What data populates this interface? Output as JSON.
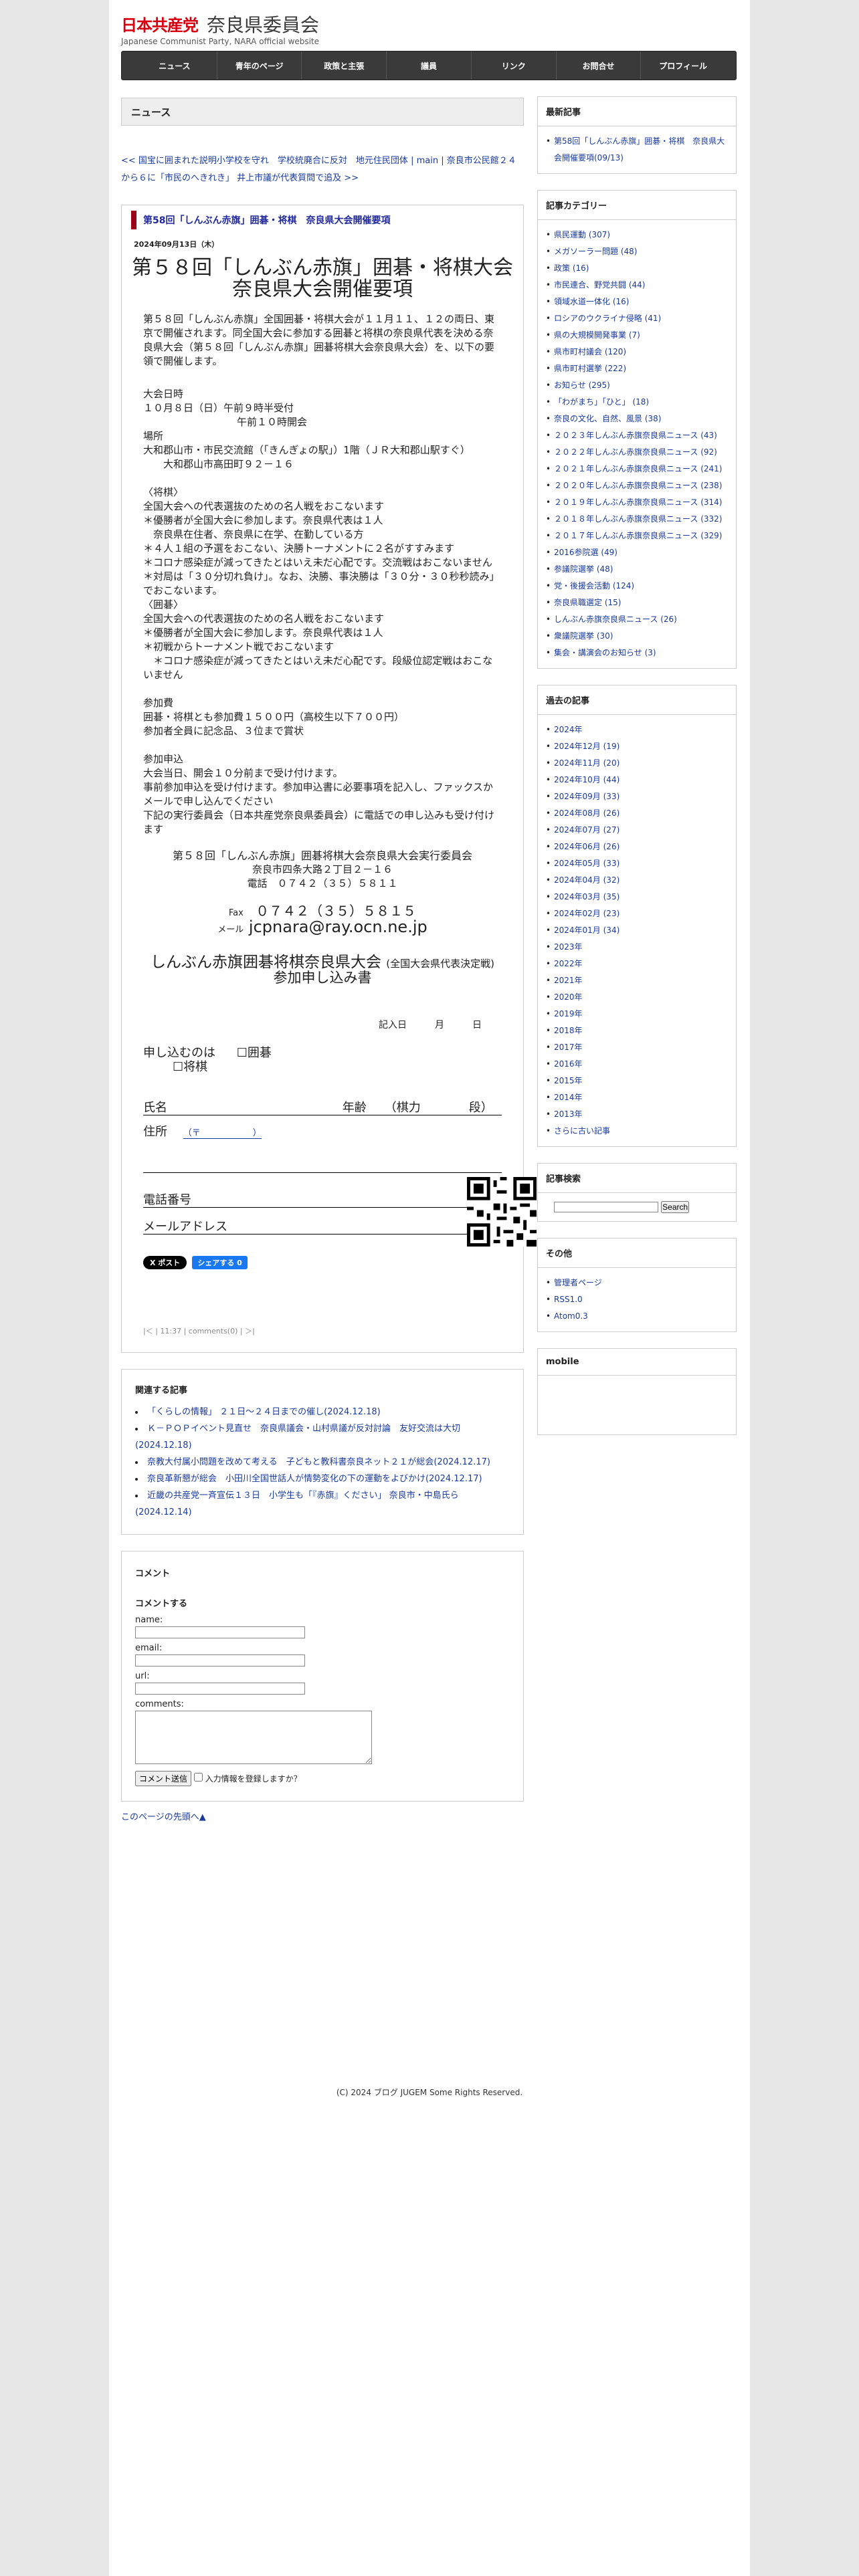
{
  "header": {
    "party": "日本共産党",
    "committee": "奈良県委員会",
    "subtitle": "Japanese Communist Party, NARA official website"
  },
  "nav": [
    "ニュース",
    "青年のページ",
    "政策と主張",
    "議員",
    "リンク",
    "お問合せ",
    "プロフィール"
  ],
  "main": {
    "section_title": "ニュース",
    "pager_prev": "<< 国宝に囲まれた説明小学校を守れ　学校統廃合に反対　地元住民団体",
    "pager_main": "main",
    "pager_next": "奈良市公民館２４から６に「市民のへきれき」 井上市議が代表質問で追及 >>",
    "entry": {
      "title": "第58回「しんぶん赤旗」囲碁・将棋　奈良県大会開催要項",
      "date": "2024年09月13日（木）",
      "big_title_1": "第５８回「しんぶん赤旗」囲碁・将棋大会",
      "big_title_2": "奈良県大会開催要項",
      "intro": "第５８回「しんぶん赤旗」全国囲碁・将棋大会が１１月１１、１２の両日、東京で開催されます。同全国大会に参加する囲碁と将棋の奈良県代表を決める奈良県大会（第５８回「しんぶん赤旗」囲碁将棋大会奈良県大会）を、以下の要領で開催します。",
      "date_h": "大会日時",
      "date_1": "１０月８日（日）午前９時半受付",
      "date_2": "午前１０時開会",
      "place_h": "場所",
      "place_1": "大和郡山市・市民交流館（「きんぎょの駅」）1階（ＪＲ大和郡山駅すぐ）",
      "place_2": "大和郡山市高田町９２－１６",
      "shogi_h": "〈将棋〉",
      "shogi_lines": [
        "全国大会への代表選抜のための名人戦をおこないます",
        "＊優勝者が全国大会に参加します。奈良県代表は１人",
        "　奈良県在住者、奈良県に在学、在勤している方",
        "＊４人１組の予選をおこない、決勝トーナメントに２名がすすみます",
        "＊コロナ感染症が減ってきたとはいえ未だ心配です。交流戦はおこないません",
        "＊対局は「３０分切れ負け」。なお、決勝、事決勝は「３０分・３０秒秒読み」でおこないます。"
      ],
      "go_h": "〈囲碁〉",
      "go_lines": [
        "全国大会への代表選抜のための名人戦をおこないます",
        "＊優勝者が全国大会に参加します。奈良県代表は１人",
        "＊初戦からトーナメント戦でおこないます",
        "　＊コロナ感染症が減ってきたとはいえ未だ心配です。段級位認定戦はおこないません"
      ],
      "fee_h": "参加費",
      "fee_1": "囲碁・将棋とも参加費１５００円（高校生以下７００円）",
      "fee_2": "参加者全員に記念品、３位まで賞状",
      "apply_h": "参加申込",
      "apply_lines": [
        "大会当日、開会１０分前まで受け付けます。",
        "事前参加申込を受け付けます。参加申込書に必要事項を記入し、ファックスかメールで申し込んでください",
        "下記の実行委員会（日本共産党奈良県委員会）に電話での申し込みも受け付けます"
      ],
      "committee": "第５８回「しんぶん赤旗」囲碁将棋大会奈良県大会実行委員会",
      "address": "奈良市四条大路２丁目２－１６",
      "tel": "電話　０７４２（３５）５８１１",
      "fax_label": "Fax",
      "fax": "０７４２（３５）５８１５",
      "mail_label": "メール",
      "mail": "jcpnara@ray.ocn.ne.jp",
      "form_title": "しんぶん赤旗囲碁将棋奈良県大会",
      "form_title_small": "(全国大会県代表決定戦)",
      "form_sub": "参加申し込み書",
      "form_date": "記入日　　　月　　　日",
      "form_apply": "申し込むのは",
      "form_go": "囲碁",
      "form_shogi": "将棋",
      "form_name": "氏名",
      "form_age": "年齢　　（棋力　　　　段）",
      "form_addr": "住所",
      "form_zip": "（〒　　　　　　）",
      "form_tel": "電話番号",
      "form_mail": "メールアドレス",
      "btn_x": "X ポスト",
      "btn_fb": "シェアする 0",
      "footer_links": "|＜ | 11:37 | comments(0) | ＞|"
    },
    "related": {
      "title": "関連する記事",
      "items": [
        "「くらしの情報」 ２１日〜２４日までの催し(2024.12.18)",
        "Ｋ－ＰＯＰイベント見直せ　奈良県議会・山村県議が反対討論　友好交流は大切(2024.12.18)",
        "奈教大付属小問題を改めて考える　子どもと教科書奈良ネット２１が総会(2024.12.17)",
        "奈良革新懇が総会　小田川全国世話人が情勢変化の下の運動をよびかけ(2024.12.17)",
        "近畿の共産党一斉宣伝１３日　小学生も「『赤旗』ください」 奈良市・中島氏ら(2024.12.14)"
      ]
    },
    "comment": {
      "title": "コメント",
      "sub": "コメントする",
      "name": "name:",
      "email": "email:",
      "url": "url:",
      "comments": "comments:",
      "submit": "コメント送信",
      "remember": "入力情報を登録しますか？"
    },
    "top_link": "このページの先頭へ▲"
  },
  "sidebar": {
    "recent_title": "最新記事",
    "recent_items": [
      "第58回「しんぶん赤旗」囲碁・将棋　奈良県大会開催要項(09/13)"
    ],
    "cat_title": "記事カテゴリー",
    "categories": [
      "県民運動 (307)",
      "メガソーラー問題 (48)",
      "政策 (16)",
      "市民連合、野党共闘 (44)",
      "領域水道一体化 (16)",
      "ロシアのウクライナ侵略 (41)",
      "県の大規模開発事業 (7)",
      "県市町村議会 (120)",
      "県市町村選挙 (222)",
      "お知らせ (295)",
      "「わがまち」「ひと」 (18)",
      "奈良の文化、自然、風景 (38)",
      "２０２３年しんぶん赤旗奈良県ニュース (43)",
      "２０２２年しんぶん赤旗奈良県ニュース (92)",
      "２０２１年しんぶん赤旗奈良県ニュース (241)",
      "２０２０年しんぶん赤旗奈良県ニュース (238)",
      "２０１９年しんぶん赤旗奈良県ニュース (314)",
      "２０１８年しんぶん赤旗奈良県ニュース (332)",
      "２０１７年しんぶん赤旗奈良県ニュース (329)",
      "2016参院選 (49)",
      "参議院選挙 (48)",
      "党・後援会活動 (124)",
      "奈良県職選定 (15)",
      "しんぶん赤旗奈良県ニュース (26)",
      "衆議院選挙 (30)",
      "集会・講演会のお知らせ (3)"
    ],
    "archive_title": "過去の記事",
    "archives": [
      "2024年",
      "2024年12月 (19)",
      "2024年11月 (20)",
      "2024年10月 (44)",
      "2024年09月 (33)",
      "2024年08月 (26)",
      "2024年07月 (27)",
      "2024年06月 (26)",
      "2024年05月 (33)",
      "2024年04月 (32)",
      "2024年03月 (35)",
      "2024年02月 (23)",
      "2024年01月 (34)",
      "2023年",
      "2022年",
      "2021年",
      "2020年",
      "2019年",
      "2018年",
      "2017年",
      "2016年",
      "2015年",
      "2014年",
      "2013年",
      "さらに古い記事"
    ],
    "search_title": "記事検索",
    "search_button": "Search",
    "other_title": "その他",
    "other_items": [
      "管理者ページ",
      "RSS1.0",
      "Atom0.3"
    ],
    "mobile_title": "mobile"
  },
  "footer": {
    "copyright": "(C) 2024 ブログ JUGEM Some Rights Reserved."
  }
}
